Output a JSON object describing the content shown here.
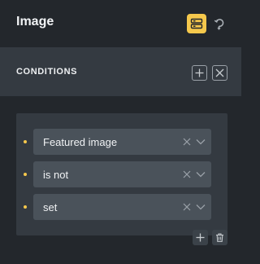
{
  "header": {
    "title": "Image",
    "toggle_icon": "dynamic-data-icon",
    "reset_icon": "reset-icon",
    "accent_color": "#f5c84c"
  },
  "conditions": {
    "title": "CONDITIONS",
    "add_icon": "plus-icon",
    "clear_icon": "close-icon"
  },
  "rules": [
    {
      "value": "Featured image"
    },
    {
      "value": "is not"
    },
    {
      "value": "set"
    }
  ],
  "group_actions": {
    "add_icon": "plus-icon",
    "delete_icon": "trash-icon"
  }
}
